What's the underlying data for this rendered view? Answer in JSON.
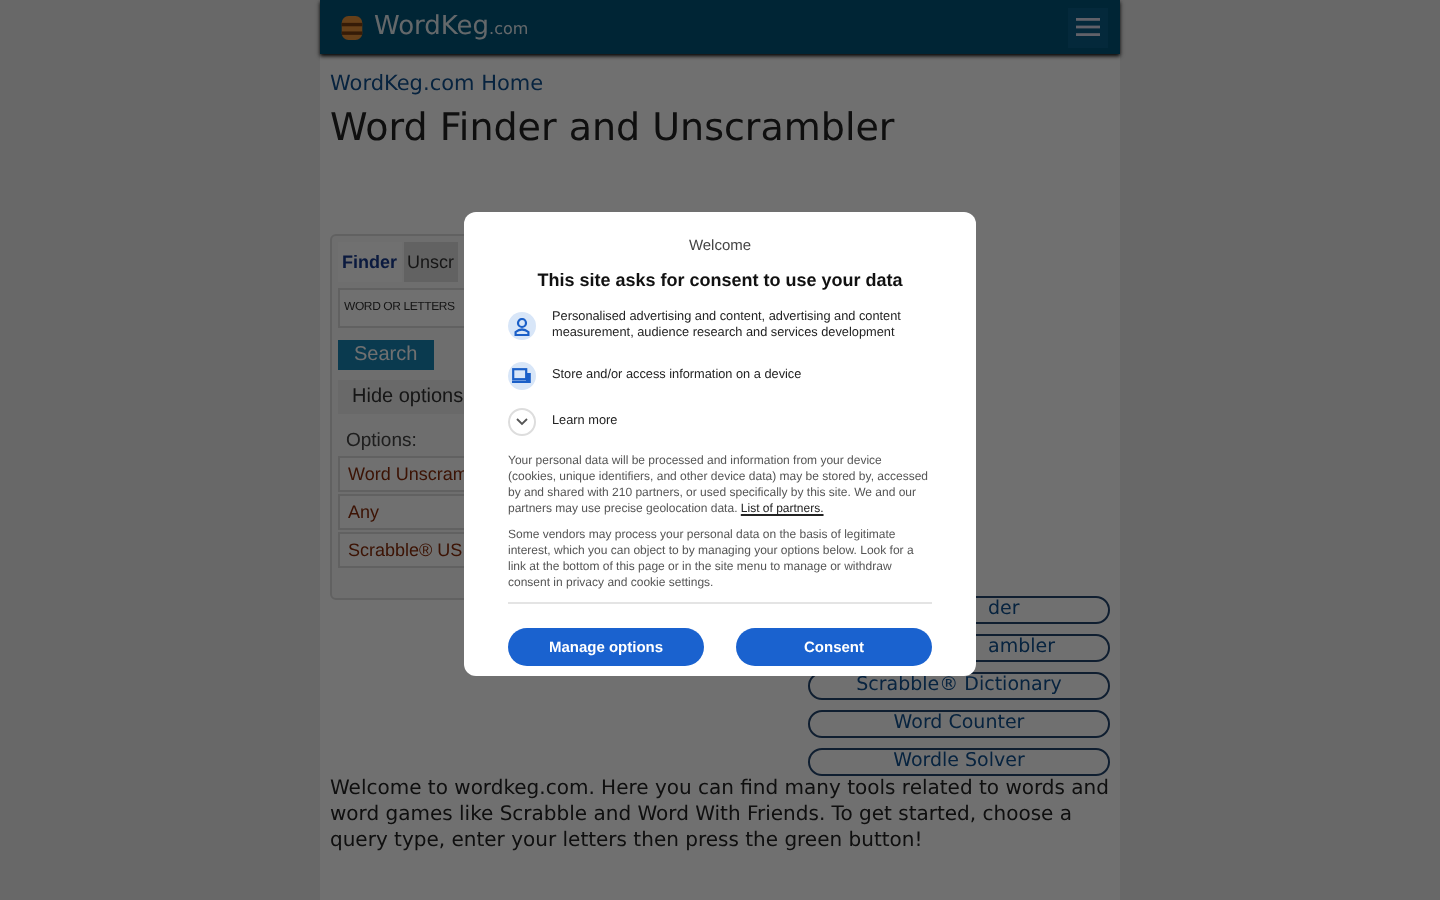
{
  "header": {
    "brand": "WordKeg",
    "brand_suffix": ".com"
  },
  "breadcrumb": "WordKeg.com Home",
  "title": "Word Finder and Unscrambler",
  "finder": {
    "tabs": [
      {
        "label": "Finder",
        "selected": true
      },
      {
        "label": "Unscr",
        "selected": false
      }
    ],
    "input": {
      "placeholder": "WORD OR LETTERS"
    },
    "search_button": "Search",
    "options_toggle": "Hide options",
    "options_label": "Options:",
    "selects": [
      "Word Unscram",
      "Any",
      "Scrabble® US"
    ]
  },
  "tools": [
    {
      "label": "der",
      "covered": true
    },
    {
      "label": "ambler",
      "covered": true
    },
    {
      "label": "Scrabble® Dictionary",
      "covered": false
    },
    {
      "label": "Word Counter",
      "covered": false
    },
    {
      "label": "Wordle Solver",
      "covered": false
    }
  ],
  "intro": "Welcome to wordkeg.com. Here you can find many tools related to words and word games like Scrabble and Word With Friends. To get started, choose a query type, enter your letters then press the green button!",
  "consent": {
    "welcome": "Welcome",
    "heading": "This site asks for consent to use your data",
    "purposes": [
      {
        "kind": "person",
        "text": "Personalised advertising and content, advertising and content measurement, audience research and services development"
      },
      {
        "kind": "device",
        "text": "Store and/or access information on a device"
      }
    ],
    "learn_more": "Learn more",
    "paragraph_1": "Your personal data will be processed and information from your device (cookies, unique identifiers, and other device data) may be stored by, accessed by and shared with 210 partners, or used specifically by this site. We and our partners may use precise geolocation data.",
    "partners_link": "List of partners.",
    "paragraph_2": "Some vendors may process your personal data on the basis of legitimate interest, which you can object to by managing your options below. Look for a link at the bottom of this page or in the site menu to manage or withdraw consent in privacy and cookie settings.",
    "buttons": [
      "Manage options",
      "Consent"
    ]
  }
}
